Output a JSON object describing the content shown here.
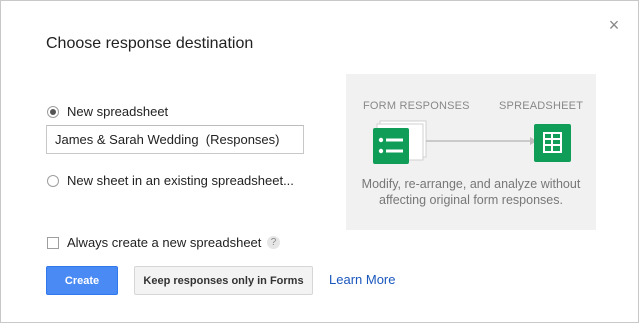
{
  "dialog": {
    "title": "Choose response destination",
    "close_symbol": "×"
  },
  "options": {
    "new_spreadsheet_label": "New spreadsheet",
    "new_spreadsheet_selected": true,
    "spreadsheet_name_value": "James & Sarah Wedding  (Responses)",
    "existing_sheet_label": "New sheet in an existing spreadsheet...",
    "existing_sheet_selected": false,
    "always_create_label": "Always create a new spreadsheet",
    "always_create_checked": false,
    "help_symbol": "?"
  },
  "illustration": {
    "form_label": "FORM RESPONSES",
    "sheet_label": "SPREADSHEET",
    "description_line1": "Modify, re-arrange, and analyze without",
    "description_line2": "affecting original form responses.",
    "forms_color": "#0f9d58",
    "sheets_color": "#0f9d58"
  },
  "buttons": {
    "create_label": "Create",
    "keep_label": "Keep responses only in Forms",
    "learn_more_label": "Learn More"
  },
  "colors": {
    "primary_button": "#4a8af4",
    "link": "#1a57bd"
  },
  "icons": [
    "close-icon",
    "radio-icon",
    "checkbox-icon",
    "help-icon",
    "forms-icon",
    "arrow-icon",
    "sheets-icon"
  ]
}
